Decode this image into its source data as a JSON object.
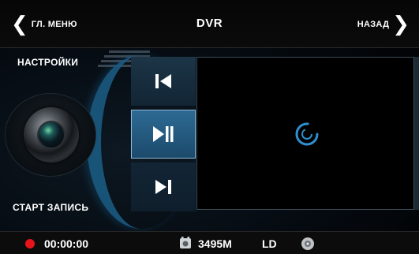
{
  "header": {
    "back_left_label": "ГЛ. МЕНЮ",
    "title": "DVR",
    "back_right_label": "НАЗАД"
  },
  "left_panel": {
    "settings_label": "НАСТРОЙКИ",
    "start_record_label": "СТАРТ ЗАПИСЬ"
  },
  "controls": {
    "prev_icon": "skip-previous-icon",
    "play_pause_icon": "play-pause-icon",
    "next_icon": "skip-next-icon"
  },
  "status": {
    "record_time": "00:00:00",
    "storage": "3495M",
    "quality": "LD"
  },
  "colors": {
    "accent": "#1c4a6c",
    "record": "#e8141c",
    "spinner": "#2f8fd0"
  }
}
